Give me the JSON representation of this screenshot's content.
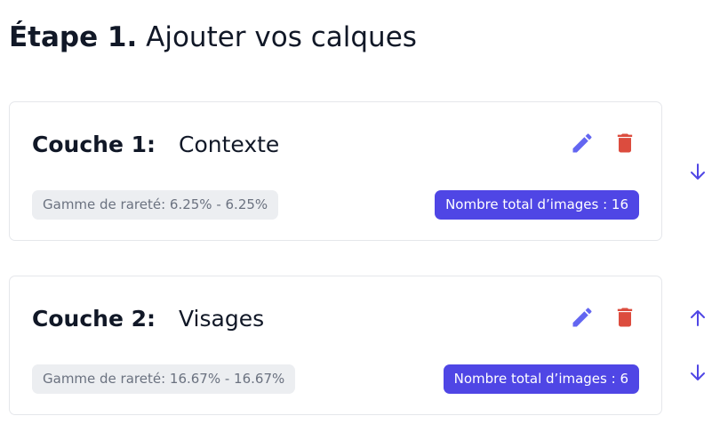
{
  "heading": {
    "step": "Étape 1.",
    "title": " Ajouter vos calques"
  },
  "layers": [
    {
      "number": "Couche 1:",
      "name": "Contexte",
      "rarity": "Gamme de rareté: 6.25% - 6.25%",
      "count": "Nombre total d’images : 16",
      "actions": [
        "edit-icon",
        "trash-icon"
      ],
      "move": [
        "arrow-down-icon"
      ]
    },
    {
      "number": "Couche 2:",
      "name": "Visages",
      "rarity": "Gamme de rareté: 16.67% - 16.67%",
      "count": "Nombre total d’images : 6",
      "actions": [
        "edit-icon",
        "trash-icon"
      ],
      "move": [
        "arrow-up-icon",
        "arrow-down-icon"
      ]
    }
  ],
  "colors": {
    "accent": "#4f46e5",
    "edit_icon": "#6366f1",
    "delete_icon": "#dc4c3e",
    "badge_bg": "#eceef1",
    "badge_text": "#6b7280",
    "card_border": "#e5e7eb"
  }
}
